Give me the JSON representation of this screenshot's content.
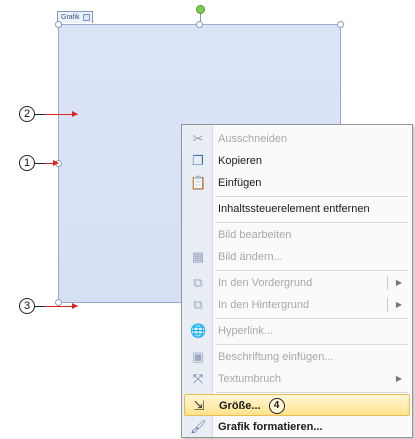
{
  "picture": {
    "tab_label": "Grafik"
  },
  "callouts": {
    "c1": "1",
    "c2": "2",
    "c3": "3",
    "c4": "4"
  },
  "menu": {
    "items": [
      {
        "label": "Ausschneiden",
        "icon": "scissors-icon",
        "state": "disabled"
      },
      {
        "label": "Kopieren",
        "icon": "copy-icon",
        "state": "enabled"
      },
      {
        "label": "Einfügen",
        "icon": "paste-icon",
        "state": "enabled"
      },
      {
        "label": "Inhaltssteuerelement entfernen",
        "icon": "",
        "state": "enabled"
      },
      {
        "label": "Bild bearbeiten",
        "icon": "",
        "state": "disabled"
      },
      {
        "label": "Bild ändern...",
        "icon": "change-picture-icon",
        "state": "disabled"
      },
      {
        "label": "In den Vordergrund",
        "icon": "bring-forward-icon",
        "state": "disabled",
        "submenu": true
      },
      {
        "label": "In den Hintergrund",
        "icon": "send-backward-icon",
        "state": "disabled",
        "submenu": true
      },
      {
        "label": "Hyperlink...",
        "icon": "hyperlink-icon",
        "state": "disabled"
      },
      {
        "label": "Beschriftung einfügen...",
        "icon": "caption-icon",
        "state": "disabled"
      },
      {
        "label": "Textumbruch",
        "icon": "text-wrap-icon",
        "state": "disabled",
        "submenu": true
      },
      {
        "label": "Größe...",
        "icon": "size-icon",
        "state": "highlighted"
      },
      {
        "label": "Grafik formatieren...",
        "icon": "format-picture-icon",
        "state": "enabled"
      }
    ]
  },
  "colors": {
    "picture_fill": "#d8e2f6",
    "arrow": "#dd2222",
    "highlight": "#ffe38a"
  }
}
